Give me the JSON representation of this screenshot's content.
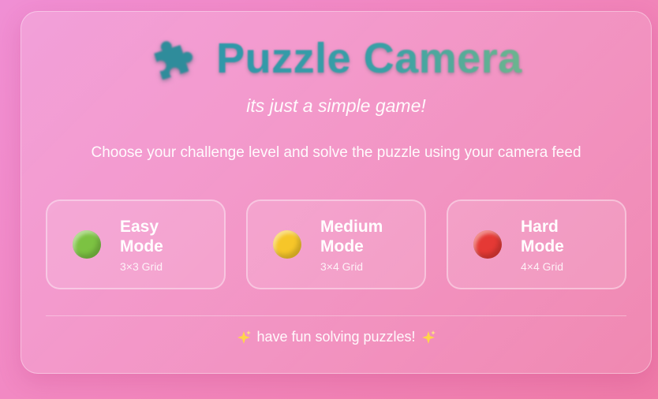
{
  "header": {
    "icon": "puzzle-piece-icon",
    "title": "Puzzle Camera",
    "subtitle": "its just a simple game!",
    "description": "Choose your challenge level and solve the puzzle using your camera feed"
  },
  "modes": [
    {
      "name": "Easy Mode",
      "grid": "3×3 Grid",
      "icon": "green-circle-icon",
      "color": "#7cc242"
    },
    {
      "name": "Medium Mode",
      "grid": "3×4 Grid",
      "icon": "yellow-circle-icon",
      "color": "#f6c629"
    },
    {
      "name": "Hard Mode",
      "grid": "4×4 Grid",
      "icon": "red-circle-icon",
      "color": "#e53935"
    }
  ],
  "footer": {
    "text": "have fun solving puzzles!",
    "icon": "sparkles-icon"
  },
  "colors": {
    "title_gradient_start": "#2f97a9",
    "title_gradient_end": "#6cb58e",
    "background": "#f288c0"
  }
}
